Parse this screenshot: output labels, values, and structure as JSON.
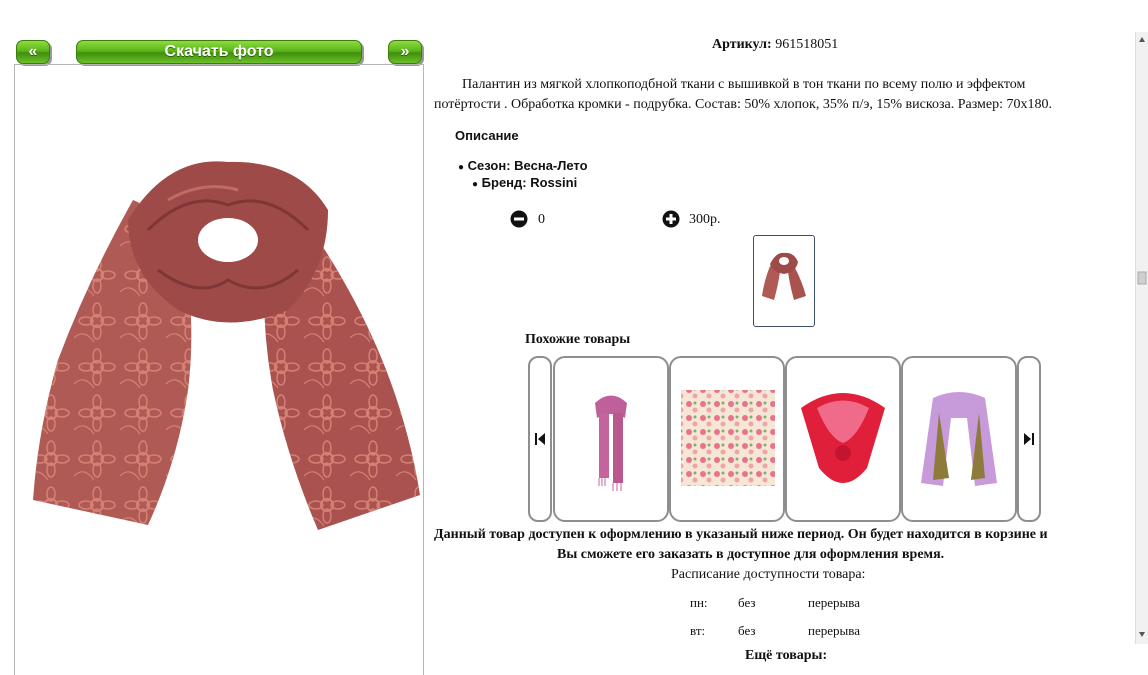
{
  "nav": {
    "prev_label": "«",
    "download_label": "Скачать фото",
    "next_label": "»"
  },
  "product": {
    "article_label": "Артикул:",
    "article_value": "961518051",
    "description_line1": "Палантин из мягкой хлопкоподбной ткани с вышивкой в тон ткани по всему полю и эффектом",
    "description_line2": "потёртости . Обработка кромки - подрубка. Состав: 50% хлопок, 35% п/э, 15% вискоза. Размер: 70х180.",
    "desc_heading": "Описание",
    "features": [
      "Сезон: Весна-Лето",
      "Бренд: Rossini"
    ],
    "quantity": "0",
    "price": "300р."
  },
  "similar": {
    "heading": "Похожие товары"
  },
  "availability": {
    "notice_line1": "Данный товар доступен к оформлению в указаный ниже период. Он будет находится в корзине и",
    "notice_line2": "Вы сможете его заказать в доступное для оформления время.",
    "schedule_title": "Расписание доступности товара:",
    "rows": [
      {
        "day": "пн:",
        "a": "без",
        "b": "перерыва"
      },
      {
        "day": "вт:",
        "a": "без",
        "b": "перерыва"
      }
    ]
  },
  "more": {
    "heading": "Ещё товары:"
  },
  "colors": {
    "scarf": "#b05a56",
    "pattern": "#d98577"
  }
}
